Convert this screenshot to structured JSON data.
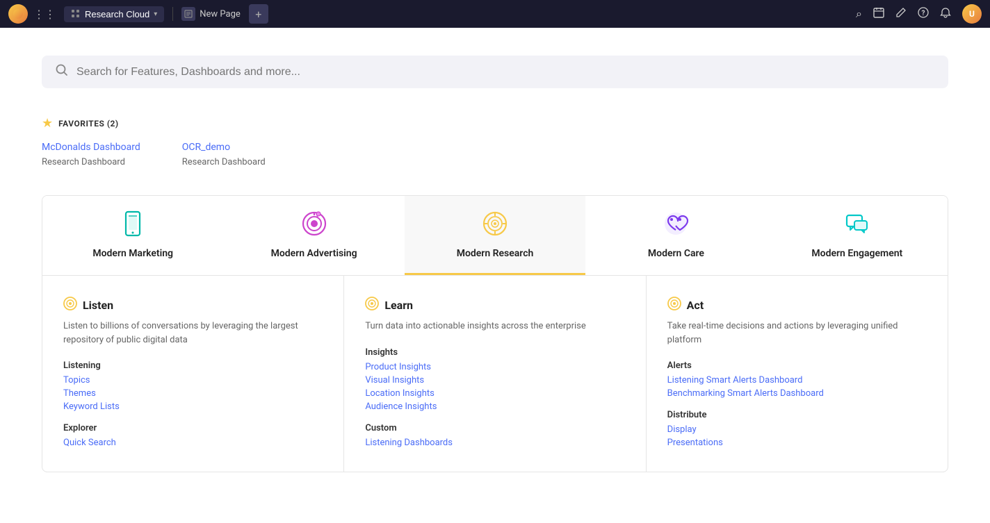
{
  "app": {
    "name": "Research Cloud",
    "logo_char": "✦",
    "new_page_label": "New Page",
    "add_label": "+"
  },
  "topnav": {
    "icons": [
      "search",
      "calendar",
      "edit",
      "help",
      "bell"
    ],
    "avatar_label": "U"
  },
  "search": {
    "placeholder": "Search for Features, Dashboards and more..."
  },
  "favorites": {
    "title": "FAVORITES (2)",
    "star": "★",
    "items": [
      {
        "name": "McDonalds Dashboard",
        "type": "Research Dashboard"
      },
      {
        "name": "OCR_demo",
        "type": "Research Dashboard"
      }
    ]
  },
  "tabs": [
    {
      "id": "modern-marketing",
      "label": "Modern Marketing",
      "icon": "phone",
      "active": false
    },
    {
      "id": "modern-advertising",
      "label": "Modern Advertising",
      "icon": "target",
      "active": false
    },
    {
      "id": "modern-research",
      "label": "Modern Research",
      "icon": "research",
      "active": true
    },
    {
      "id": "modern-care",
      "label": "Modern Care",
      "icon": "care",
      "active": false
    },
    {
      "id": "modern-engagement",
      "label": "Modern Engagement",
      "icon": "chat",
      "active": false
    }
  ],
  "panels": [
    {
      "id": "listen",
      "icon": "🌐",
      "title": "Listen",
      "desc": "Listen to billions of conversations by leveraging the largest repository of public digital data",
      "sections": [
        {
          "title": "Listening",
          "links": [
            "Topics",
            "Themes",
            "Keyword Lists"
          ]
        },
        {
          "title": "Explorer",
          "links": [
            "Quick Search"
          ]
        }
      ]
    },
    {
      "id": "learn",
      "icon": "🌐",
      "title": "Learn",
      "desc": "Turn data into actionable insights across the enterprise",
      "sections": [
        {
          "title": "Insights",
          "links": [
            "Product Insights",
            "Visual Insights",
            "Location Insights",
            "Audience Insights"
          ]
        },
        {
          "title": "Custom",
          "links": [
            "Listening Dashboards"
          ]
        }
      ]
    },
    {
      "id": "act",
      "icon": "🌐",
      "title": "Act",
      "desc": "Take real-time decisions and actions by leveraging unified platform",
      "sections": [
        {
          "title": "Alerts",
          "links": [
            "Listening Smart Alerts Dashboard",
            "Benchmarking Smart Alerts Dashboard"
          ]
        },
        {
          "title": "Distribute",
          "links": [
            "Display",
            "Presentations"
          ]
        }
      ]
    }
  ]
}
